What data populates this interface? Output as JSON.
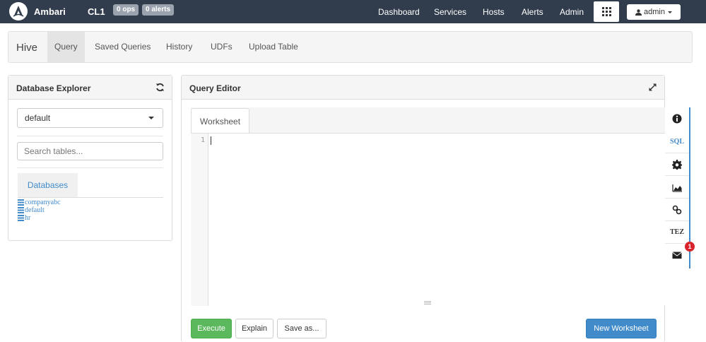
{
  "navbar": {
    "brand": "Ambari",
    "cluster": "CL1",
    "ops_badge": "0 ops",
    "alerts_badge": "0 alerts",
    "links": [
      "Dashboard",
      "Services",
      "Hosts",
      "Alerts",
      "Admin"
    ],
    "user_label": "admin",
    "colors": {
      "background": "#313d4d",
      "badge": "#9aa3ad"
    }
  },
  "subnav": {
    "title": "Hive",
    "tabs": [
      "Query",
      "Saved Queries",
      "History",
      "UDFs",
      "Upload Table"
    ],
    "active_tab": "Query"
  },
  "database_explorer": {
    "title": "Database Explorer",
    "selected_database": "default",
    "search_placeholder": "Search tables...",
    "tab_label": "Databases",
    "databases": [
      "companyabc",
      "default",
      "hr"
    ]
  },
  "query_editor": {
    "title": "Query Editor",
    "worksheet_tab": "Worksheet",
    "line_numbers": [
      "1"
    ],
    "buttons": {
      "execute": "Execute",
      "explain": "Explain",
      "save_as": "Save as...",
      "new_worksheet": "New Worksheet"
    },
    "colors": {
      "execute": "#5cb85c",
      "new_worksheet": "#428bca"
    }
  },
  "side_toolbar": {
    "sql_label": "SQL",
    "tez_label": "TEZ",
    "notification_count": "1",
    "icons": [
      "info-icon",
      "sql-text",
      "gear-icon",
      "chart-icon",
      "link-icon",
      "tez-text",
      "envelope-icon"
    ]
  }
}
